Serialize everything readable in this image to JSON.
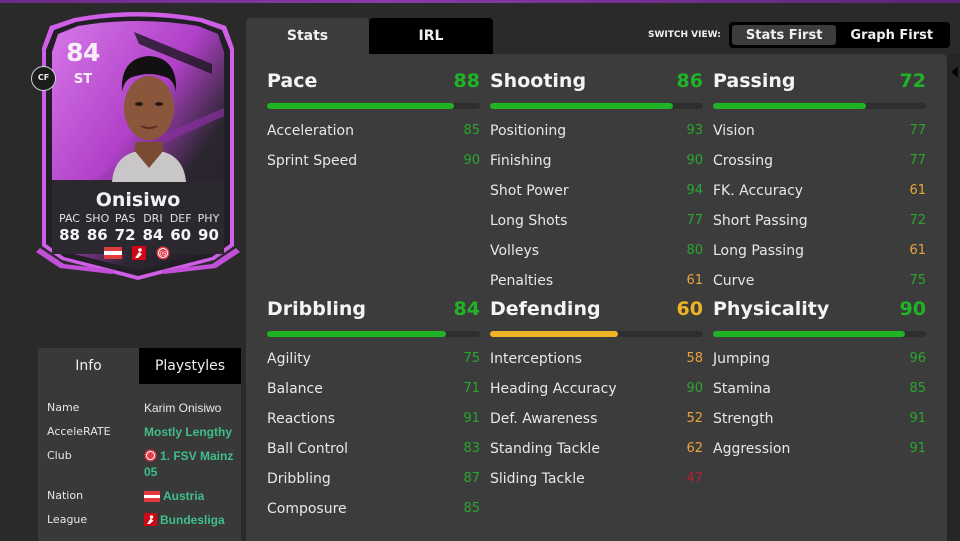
{
  "colors": {
    "green": "#21b326",
    "green_text": "#2aa62e",
    "yellow": "#f0b323",
    "orange_text": "#e8a33a",
    "red_text": "#b3212e",
    "link_green": "#3fbf8a",
    "card_purple": "#c24fd8"
  },
  "card": {
    "rating": "84",
    "position": "ST",
    "alt_position": "CF",
    "name": "Onisiwo",
    "attribute_labels": [
      "PAC",
      "SHO",
      "PAS",
      "DRI",
      "DEF",
      "PHY"
    ],
    "attribute_values": [
      "88",
      "86",
      "72",
      "84",
      "60",
      "90"
    ],
    "badges": [
      "austria-flag-icon",
      "bundesliga-logo-icon",
      "mainz-crest-icon"
    ]
  },
  "info": {
    "tabs": [
      "Info",
      "Playstyles"
    ],
    "active_tab": "Info",
    "rows": [
      {
        "key": "Name",
        "value": "Karim Onisiwo",
        "style": "plain"
      },
      {
        "key": "AcceleRATE",
        "value": "Mostly Lengthy",
        "style": "link"
      },
      {
        "key": "Club",
        "value": "1. FSV Mainz 05",
        "style": "link",
        "icon": "mainz-crest-icon"
      },
      {
        "key": "Nation",
        "value": "Austria",
        "style": "link",
        "icon": "austria-flag-icon"
      },
      {
        "key": "League",
        "value": "Bundesliga",
        "style": "link",
        "icon": "bundesliga-logo-icon"
      }
    ]
  },
  "main_tabs": [
    "Stats",
    "IRL"
  ],
  "main_active_tab": "Stats",
  "switch_view": {
    "label": "SWITCH VIEW:",
    "options": [
      "Stats First",
      "Graph First"
    ],
    "selected": "Stats First"
  },
  "stat_groups": [
    {
      "title": "Pace",
      "total": 88,
      "level": "green",
      "stats": [
        {
          "name": "Acceleration",
          "value": 85
        },
        {
          "name": "Sprint Speed",
          "value": 90
        }
      ]
    },
    {
      "title": "Shooting",
      "total": 86,
      "level": "green",
      "stats": [
        {
          "name": "Positioning",
          "value": 93
        },
        {
          "name": "Finishing",
          "value": 90
        },
        {
          "name": "Shot Power",
          "value": 94
        },
        {
          "name": "Long Shots",
          "value": 77
        },
        {
          "name": "Volleys",
          "value": 80
        },
        {
          "name": "Penalties",
          "value": 61
        }
      ]
    },
    {
      "title": "Passing",
      "total": 72,
      "level": "green",
      "stats": [
        {
          "name": "Vision",
          "value": 77
        },
        {
          "name": "Crossing",
          "value": 77
        },
        {
          "name": "FK. Accuracy",
          "value": 61
        },
        {
          "name": "Short Passing",
          "value": 72
        },
        {
          "name": "Long Passing",
          "value": 61
        },
        {
          "name": "Curve",
          "value": 75
        }
      ]
    },
    {
      "title": "Dribbling",
      "total": 84,
      "level": "green",
      "stats": [
        {
          "name": "Agility",
          "value": 75
        },
        {
          "name": "Balance",
          "value": 71
        },
        {
          "name": "Reactions",
          "value": 91
        },
        {
          "name": "Ball Control",
          "value": 83
        },
        {
          "name": "Dribbling",
          "value": 87
        },
        {
          "name": "Composure",
          "value": 85
        }
      ]
    },
    {
      "title": "Defending",
      "total": 60,
      "level": "yellow",
      "stats": [
        {
          "name": "Interceptions",
          "value": 58
        },
        {
          "name": "Heading Accuracy",
          "value": 90
        },
        {
          "name": "Def. Awareness",
          "value": 52
        },
        {
          "name": "Standing Tackle",
          "value": 62
        },
        {
          "name": "Sliding Tackle",
          "value": 47
        }
      ]
    },
    {
      "title": "Physicality",
      "total": 90,
      "level": "green",
      "stats": [
        {
          "name": "Jumping",
          "value": 96
        },
        {
          "name": "Stamina",
          "value": 85
        },
        {
          "name": "Strength",
          "value": 91
        },
        {
          "name": "Aggression",
          "value": 91
        }
      ]
    }
  ]
}
